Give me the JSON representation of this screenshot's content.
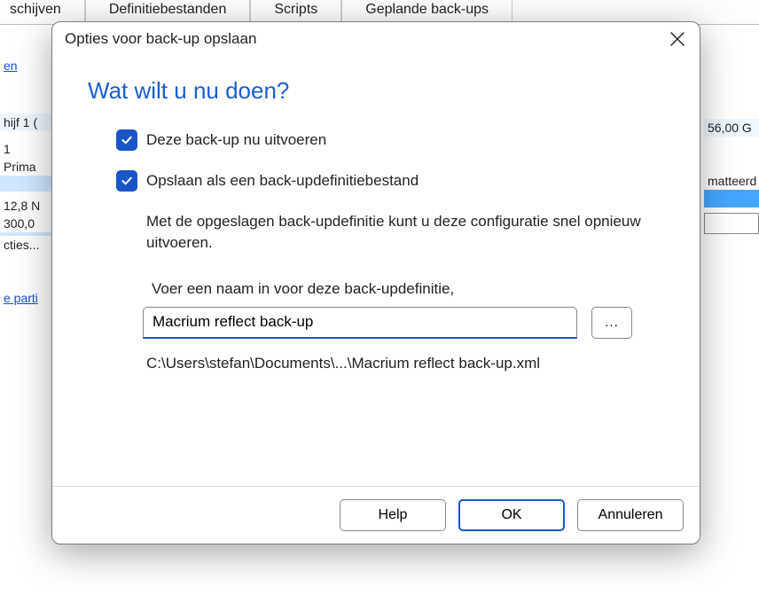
{
  "background": {
    "tabs": [
      "schijven",
      "Definitiebestanden",
      "Scripts",
      "Geplande back-ups"
    ],
    "left": {
      "link1": "en",
      "disk": "hijf 1 (",
      "num": "1",
      "prima": "Prima",
      "size1": "12,8 N",
      "size2": "300,0",
      "cties": "cties...",
      "parti": "e parti"
    },
    "right": {
      "gsize": "56,00 G",
      "matt": "matteerd"
    }
  },
  "dialog": {
    "title": "Opties voor back-up opslaan",
    "heading": "Wat wilt u nu doen?",
    "check1_label": "Deze back-up nu uitvoeren",
    "check2_label": "Opslaan als een back-updefinitiebestand",
    "description": "Met de opgeslagen back-updefinitie kunt u deze configuratie snel opnieuw uitvoeren.",
    "field_label": "Voer een naam in voor deze back-updefinitie,",
    "name_value": "Macrium reflect back-up",
    "browse_label": "...",
    "path": "C:\\Users\\stefan\\Documents\\...\\Macrium reflect back-up.xml",
    "buttons": {
      "help": "Help",
      "ok": "OK",
      "cancel": "Annuleren"
    }
  }
}
